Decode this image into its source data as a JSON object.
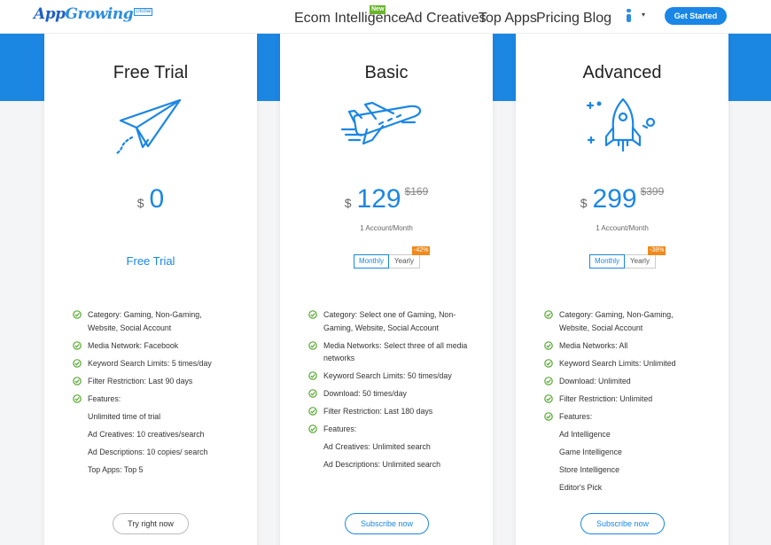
{
  "header": {
    "logo": {
      "part1": "App",
      "part2": "Growing",
      "badge": "Global"
    },
    "nav": [
      {
        "label": "Ecom Intelligence",
        "badge": "New"
      },
      {
        "label": "Ad Creatives"
      },
      {
        "label": "Top Apps"
      },
      {
        "label": "Pricing"
      },
      {
        "label": "Blog"
      }
    ],
    "user_caret": "▾",
    "cta": "Get Started"
  },
  "plans": [
    {
      "title": "Free Trial",
      "icon": "paper-plane-icon",
      "currency": "$",
      "price": "0",
      "cta_text": "Free Trial",
      "features": [
        {
          "text": "Category: Gaming, Non-Gaming, Website, Social Account",
          "check": true
        },
        {
          "text": "Media Network: Facebook",
          "check": true
        },
        {
          "text": "Keyword Search Limits: 5 times/day",
          "check": true
        },
        {
          "text": "Filter Restriction: Last 90 days",
          "check": true
        },
        {
          "text": "Features:",
          "check": true
        },
        {
          "text": "Unlimited time of trial",
          "check": false
        },
        {
          "text": "Ad Creatives: 10 creatives/search",
          "check": false
        },
        {
          "text": "Ad Descriptions: 10 copies/ search",
          "check": false
        },
        {
          "text": "Top Apps: Top 5",
          "check": false
        }
      ],
      "button": "Try right now"
    },
    {
      "title": "Basic",
      "icon": "airplane-icon",
      "currency": "$",
      "price": "129",
      "old_price": "$169",
      "per": "1 Account/Month",
      "toggle": {
        "monthly": "Monthly",
        "yearly": "Yearly",
        "discount": "-42%"
      },
      "features": [
        {
          "text": "Category: Select one of Gaming, Non-Gaming, Website, Social Account",
          "check": true
        },
        {
          "text": "Media Networks: Select three of all media networks",
          "check": true
        },
        {
          "text": "Keyword Search Limits: 50 times/day",
          "check": true
        },
        {
          "text": "Download: 50 times/day",
          "check": true
        },
        {
          "text": "Filter Restriction: Last 180 days",
          "check": true
        },
        {
          "text": "Features:",
          "check": true
        },
        {
          "text": "Ad Creatives: Unlimited search",
          "check": false
        },
        {
          "text": "Ad Descriptions: Unlimited search",
          "check": false
        }
      ],
      "button": "Subscribe now"
    },
    {
      "title": "Advanced",
      "icon": "rocket-icon",
      "currency": "$",
      "price": "299",
      "old_price": "$399",
      "per": "1 Account/Month",
      "toggle": {
        "monthly": "Monthly",
        "yearly": "Yearly",
        "discount": "-38%"
      },
      "features": [
        {
          "text": "Category: Gaming, Non-Gaming, Website, Social Account",
          "check": true
        },
        {
          "text": "Media Networks: All",
          "check": true
        },
        {
          "text": "Keyword Search Limits: Unlimited",
          "check": true
        },
        {
          "text": "Download: Unlimited",
          "check": true
        },
        {
          "text": "Filter Restriction: Unlimited",
          "check": true
        },
        {
          "text": "Features:",
          "check": true
        },
        {
          "text": "Ad Intelligence",
          "check": false
        },
        {
          "text": "Game Intelligence",
          "check": false
        },
        {
          "text": "Store Intelligence",
          "check": false
        },
        {
          "text": "Editor's Pick",
          "check": false
        }
      ],
      "button": "Subscribe now"
    }
  ],
  "colors": {
    "accent": "#1b87e3",
    "check": "#58a832",
    "discount": "#f08a1c",
    "new_badge": "#6ab52c"
  }
}
